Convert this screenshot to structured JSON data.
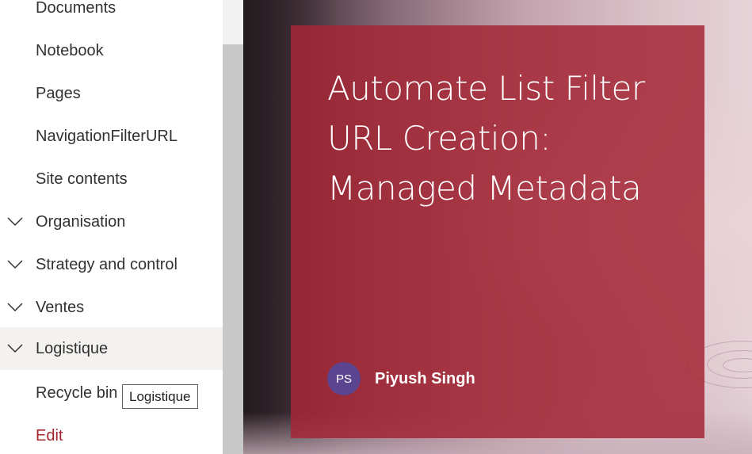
{
  "nav": {
    "items": [
      {
        "label": "Documents",
        "expandable": false
      },
      {
        "label": "Notebook",
        "expandable": false
      },
      {
        "label": "Pages",
        "expandable": false
      },
      {
        "label": "NavigationFilterURL",
        "expandable": false
      },
      {
        "label": "Site contents",
        "expandable": false
      },
      {
        "label": "Organisation",
        "expandable": true
      },
      {
        "label": "Strategy and control",
        "expandable": true
      },
      {
        "label": "Ventes",
        "expandable": true
      },
      {
        "label": "Logistique",
        "expandable": true,
        "selected": true
      },
      {
        "label": "Recycle bin",
        "expandable": false
      },
      {
        "label": "Edit",
        "expandable": false
      }
    ],
    "tooltip": "Logistique",
    "chevron_icon": "chevron-down-icon"
  },
  "hero": {
    "title": "Automate List Filter URL Creation: Managed Metadata",
    "author_initials": "PS",
    "author_name": "Piyush Singh",
    "card_color": "#a42634",
    "avatar_color": "#5c4590"
  },
  "colors": {
    "edit_link": "#a4262c",
    "selected_bg": "#f3f2f1"
  }
}
